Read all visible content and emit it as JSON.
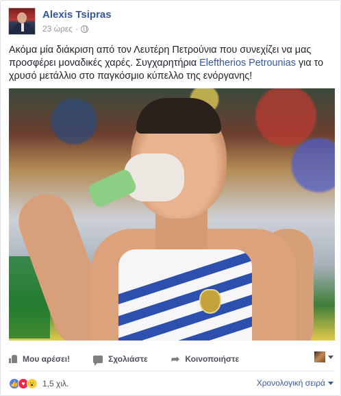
{
  "post": {
    "author": "Alexis Tsipras",
    "time": "23 ώρες",
    "separator": "·",
    "text_before_link": "Ακόμα μία διάκριση από τον Λευτέρη Πετρούνια που συνεχίζει να μας προσφέρει μοναδικές χαρές. Συγχαρητήρια ",
    "link_text": "Eleftherios Petrounias",
    "text_after_link": " για το χρυσό μετάλλιο στο παγκόσμιο κύπελλο της ενόργανης!",
    "photo_caption": ""
  },
  "actions": {
    "like": "Μου αρέσει!",
    "comment": "Σχολιάστε",
    "share": "Κοινοποιήστε"
  },
  "summary": {
    "reaction_count": "1,5 χιλ.",
    "sort_label": "Χρονολογική σειρά"
  },
  "icons": {
    "privacy": "globe-icon",
    "more": "chevron-down-icon",
    "like": "thumbs-up-icon",
    "comment": "comment-icon",
    "share": "share-icon",
    "reactions": [
      "like-reaction-icon",
      "love-reaction-icon",
      "wow-reaction-icon"
    ]
  },
  "colors": {
    "link": "#365899",
    "like_reaction": "#4e7ce8",
    "love_reaction": "#f0284a",
    "wow_reaction": "#f7d34a"
  }
}
